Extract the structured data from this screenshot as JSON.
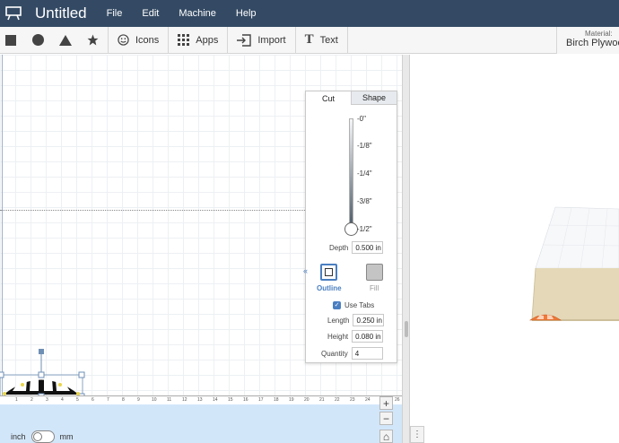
{
  "app": {
    "title": "Untitled",
    "menu": [
      "File",
      "Edit",
      "Machine",
      "Help"
    ]
  },
  "toolbar": {
    "shapes": [
      "square-icon",
      "circle-icon",
      "triangle-icon",
      "star-icon"
    ],
    "icons_label": "Icons",
    "apps_label": "Apps",
    "import_label": "Import",
    "text_label": "Text",
    "text_glyph": "T",
    "material_label": "Material:",
    "material_value": "Birch Plywood"
  },
  "panel": {
    "tabs": [
      "Cut",
      "Shape"
    ],
    "depth_ticks": [
      "-0\"",
      "-1/8\"",
      "-1/4\"",
      "-3/8\"",
      "-1/2\""
    ],
    "depth_label": "Depth",
    "depth_value": "0.500 in",
    "outline_label": "Outline",
    "fill_label": "Fill",
    "use_tabs_label": "Use Tabs",
    "use_tabs_checked": true,
    "length_label": "Length",
    "length_value": "0.250 in",
    "height_label": "Height",
    "height_value": "0.080 in",
    "quantity_label": "Quantity",
    "quantity_value": "4",
    "collapse_glyph": "«"
  },
  "canvas": {
    "ruler_numbers": [
      "1",
      "2",
      "3",
      "4",
      "5",
      "6",
      "7",
      "8",
      "9",
      "10",
      "11",
      "12",
      "13",
      "14",
      "15",
      "16",
      "17",
      "18",
      "19",
      "20",
      "21",
      "22",
      "23",
      "24",
      "25",
      "26"
    ],
    "unit_left": "inch",
    "unit_right": "mm",
    "zoom_in": "+",
    "zoom_out": "−",
    "home_glyph": "⌂"
  },
  "preview": {
    "menu_glyph": "⋮"
  },
  "colors": {
    "topbar": "#344a64",
    "accent": "#4a7fc1",
    "canvas_floor": "#d2e6f9",
    "wood": "#e4d8b8",
    "cut_part": "#f07a3a"
  }
}
